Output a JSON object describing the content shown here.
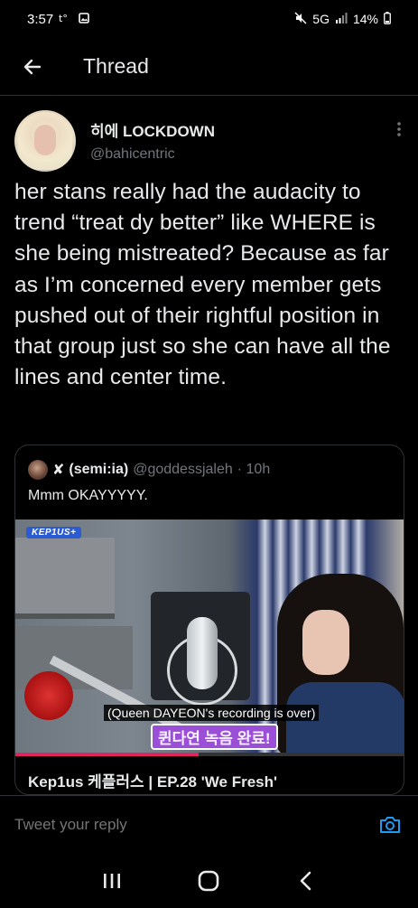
{
  "status_bar": {
    "time": "3:57",
    "left_icons": [
      "notification-icon",
      "gallery-icon"
    ],
    "network": "5G",
    "battery": "14%",
    "right_icons": [
      "mute-icon",
      "signal-icon",
      "battery-icon"
    ]
  },
  "header": {
    "title": "Thread"
  },
  "tweet": {
    "display_name": "히에 LOCKDOWN",
    "handle": "@bahicentric",
    "text": "her stans really had the audacity to trend “treat dy better” like WHERE is she being mistreated? Because as far as I’m concerned every member gets pushed out of their rightful position in that group just so she can have all the lines and center time."
  },
  "quoted_tweet": {
    "name": "(semi:ia)",
    "handle": "@goddessjaleh",
    "time": "· 10h",
    "text": "Mmm OKAYYYYY.",
    "media": {
      "logo_text": "KEP1US+",
      "caption_en": "(Queen DAYEON's recording is over)",
      "caption_ko": "퀸다연 녹음 완료!",
      "progress": 0.47
    },
    "link_title": "Kep1us 케플러스 | EP.28 'We Fresh'"
  },
  "reply_bar": {
    "placeholder": "Tweet your reply"
  },
  "nav_bar": {
    "buttons": [
      "recents-icon",
      "home-icon",
      "back-icon"
    ]
  },
  "colors": {
    "background": "#000000",
    "text": "#e7e9ea",
    "secondary_text": "#71767b",
    "divider": "#2f3336",
    "accent": "#1d9bf0"
  }
}
